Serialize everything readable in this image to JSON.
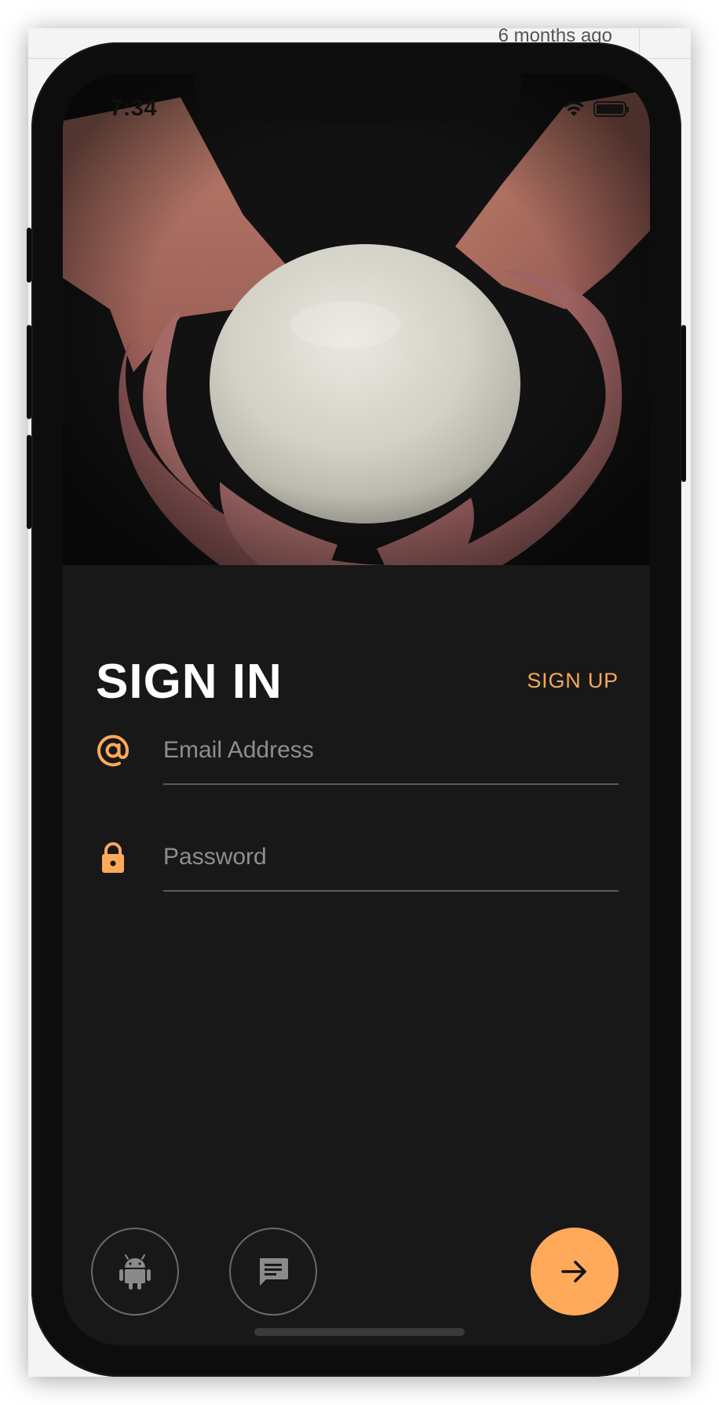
{
  "backdrop": {
    "timestamp": "6 months ago"
  },
  "status_bar": {
    "time": "7:34",
    "icons": [
      "wifi-icon",
      "battery-icon"
    ]
  },
  "hero": {
    "image": "hands-holding-dough-ball"
  },
  "auth": {
    "title": "SIGN IN",
    "switch_label": "SIGN UP",
    "email": {
      "placeholder": "Email Address",
      "value": "",
      "icon": "at-sign-icon"
    },
    "password": {
      "placeholder": "Password",
      "value": "",
      "icon": "lock-icon"
    }
  },
  "actions": {
    "android_icon": "android-icon",
    "chat_icon": "chat-icon",
    "submit_icon": "arrow-right-icon"
  },
  "colors": {
    "accent": "#ffa95a",
    "background": "#181818",
    "text_primary": "#ffffff",
    "placeholder": "#8e8e8e",
    "divider": "#5a5a5a",
    "outline_button": "#6a6a6a"
  }
}
